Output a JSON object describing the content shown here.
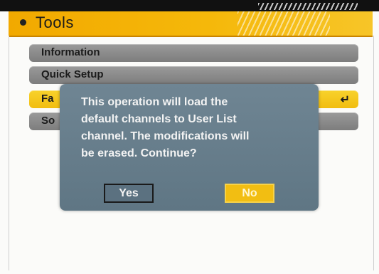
{
  "title": "Tools",
  "menu": {
    "items": [
      {
        "label": "Information"
      },
      {
        "label": "Quick Setup"
      },
      {
        "label": "Fa"
      },
      {
        "label": "So"
      }
    ]
  },
  "dialog": {
    "message": "This operation will load the\ndefault channels to User List\nchannel. The modifications will\nbe erased. Continue?",
    "yes_label": "Yes",
    "no_label": "No"
  },
  "icons": {
    "enter": "enter-return-icon",
    "bullet": "bullet-dot-icon"
  },
  "colors": {
    "header": "#f2a900",
    "selected": "#f1bd10",
    "menu_item": "#8a8a8a",
    "dialog": "#66808e"
  }
}
